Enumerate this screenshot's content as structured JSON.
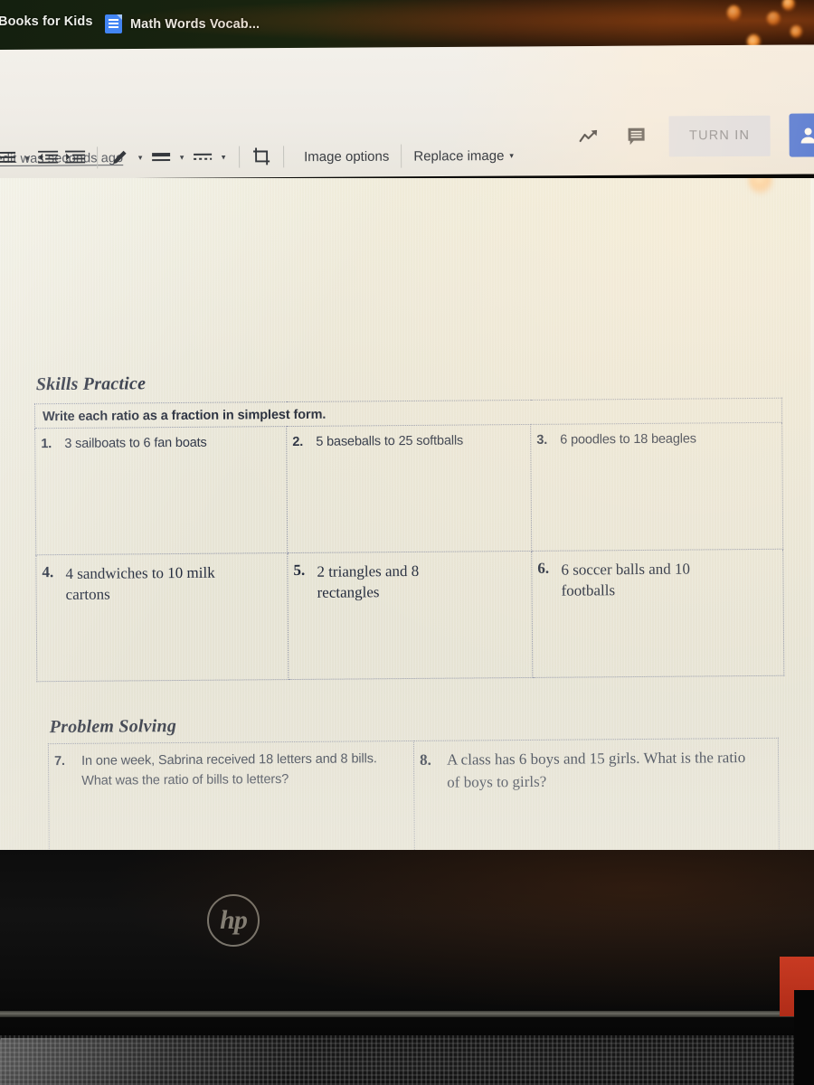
{
  "browser": {
    "tabs": [
      {
        "label": "Books for Kids",
        "icon": null
      },
      {
        "label": "Math Words Vocab...",
        "icon": "google-docs-icon"
      }
    ]
  },
  "app_header": {
    "last_edit": "edit was seconds ago",
    "activity_icon": "trending-up-icon",
    "comment_icon": "comment-icon",
    "turn_in_label": "TURN IN",
    "avatar_icon": "person-icon",
    "turn_in_bg": "#d7dce8",
    "avatar_bg": "#2b5fd9"
  },
  "toolbar": {
    "items": [
      {
        "name": "list-options",
        "icon": "list-icon",
        "caret": "▾"
      },
      {
        "name": "decrease-indent",
        "icon": "decrease-indent-icon"
      },
      {
        "name": "increase-indent",
        "icon": "increase-indent-icon"
      },
      {
        "name": "border-color",
        "icon": "pencil-icon",
        "caret": "▾"
      },
      {
        "name": "border-weight",
        "icon": "border-weight-icon",
        "caret": "▾"
      },
      {
        "name": "border-dash",
        "icon": "border-dash-icon",
        "caret": "▾"
      },
      {
        "name": "crop",
        "icon": "crop-icon"
      }
    ],
    "image_options_label": "Image options",
    "replace_image_label": "Replace image",
    "replace_image_caret": "▾"
  },
  "worksheet": {
    "skills": {
      "title": "Skills Practice",
      "instruction": "Write each ratio as a fraction in simplest form.",
      "rows": [
        {
          "style": "sans",
          "cells": [
            {
              "num": "1.",
              "text": "3 sailboats to 6 fan boats"
            },
            {
              "num": "2.",
              "text": "5 baseballs to 25 softballs"
            },
            {
              "num": "3.",
              "text": "6 poodles to 18 beagles"
            }
          ]
        },
        {
          "style": "serif",
          "cells": [
            {
              "num": "4.",
              "text": "4 sandwiches to 10 milk cartons"
            },
            {
              "num": "5.",
              "text": "2 triangles and 8 rectangles"
            },
            {
              "num": "6.",
              "text": "6 soccer balls and 10 footballs"
            }
          ]
        }
      ]
    },
    "problem_solving": {
      "title": "Problem Solving",
      "cells": [
        {
          "style": "sans",
          "num": "7.",
          "text": "In one week, Sabrina received 18 letters and 8 bills. What was the ratio of bills to letters?"
        },
        {
          "style": "serif",
          "num": "8.",
          "text": "A class has 6 boys and 15 girls.  What is the ratio of boys to girls?"
        }
      ]
    },
    "page_bg": "#e8e5d6",
    "border_color": "#8e93a6",
    "text_color": "#222a3c"
  },
  "device": {
    "brand_logo": "hp",
    "accent_color": "#c83a22"
  }
}
